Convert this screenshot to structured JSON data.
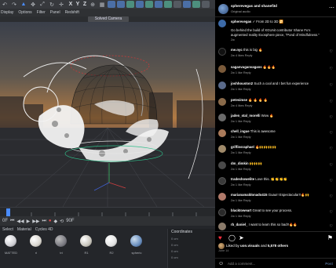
{
  "app": {
    "menu": [
      "Display",
      "Options",
      "Filter",
      "Panel",
      "Redshift"
    ],
    "camera_label": "Solved Camera",
    "axes": [
      "X",
      "Y",
      "Z"
    ],
    "transport_labels": [
      "0F",
      "90F"
    ],
    "material_tabs": [
      "Select",
      "Material",
      "Cycles 4D"
    ],
    "materials": [
      {
        "label": "MATTED",
        "color": "#cfcfd4"
      },
      {
        "label": "ri",
        "color": "#d9d6cf"
      },
      {
        "label": "tri",
        "color": "#7b7b82"
      },
      {
        "label": "R1",
        "color": "#c9c6bd"
      },
      {
        "label": "R2",
        "color": "#e3e3e3"
      },
      {
        "label": "spheric",
        "color": "#6a8fbf"
      }
    ],
    "coords_title": "Coordinates",
    "coords_rows": [
      "0 cm",
      "0 cm",
      "0 cm",
      "0 cm"
    ]
  },
  "panel": {
    "header": {
      "name": "spherevegas and shanef3d",
      "sub": "Original audio"
    },
    "comments": [
      {
        "user": "spherevegas",
        "text": "✓ From 2D to 3D 🔁",
        "detail": "Go behind the build of XGUnit contributor Shane Fu's augmented reality Exosphere piece, \"Pond of Mindfulness.\"",
        "meta": "2w",
        "color": "#3c6aa8"
      },
      {
        "user": "me.nyc",
        "text": "this is big 🔥",
        "meta": "2w   4 likes   Reply",
        "color": "#111"
      },
      {
        "user": "saganvaganvagans",
        "text": "🔥🔥🔥",
        "meta": "2w   1 like   Reply",
        "color": "#7a5a3a"
      },
      {
        "user": "joshhouston2",
        "text": "Such a cool and I bet fun experience",
        "meta": "2w   1 like   Reply",
        "color": "#5a6a8a"
      },
      {
        "user": "petesimse",
        "text": "🔥 🔥 🔥 🔥",
        "meta": "2w   4 likes   Reply",
        "color": "#8a6a4a"
      },
      {
        "user": "jaden_stal_morelli",
        "text": "Wow 🔥",
        "meta": "2w   1 like   Reply",
        "color": "#6a6a6a"
      },
      {
        "user": "chell_ingue",
        "text": "This is awesome",
        "meta": "2w   1 like   Reply",
        "color": "#aa7a5a"
      },
      {
        "user": "griffinsraphael",
        "text": "🔥🙌🙌🙌🙌",
        "meta": "2w   1 like   Reply",
        "color": "#a08a6a"
      },
      {
        "user": "dm_dimkin",
        "text": "🙌🙌🙌",
        "meta": "2w   1 like   Reply",
        "color": "#4a4a4a"
      },
      {
        "user": "tradeshowelite",
        "text": "Love this. 👏👏👏👏",
        "meta": "2w   1 like   Reply",
        "color": "#3a3a3a"
      },
      {
        "user": "marianamaldonado415",
        "text": "Guau!! Espectacular!!🔥🙌",
        "meta": "2w   1 like   Reply",
        "color": "#b07a6a"
      },
      {
        "user": "blacktoweart",
        "text": "Great to see your process.",
        "meta": "2w   1 like   Reply",
        "color": "#2a2a2a"
      },
      {
        "user": "rb_daniel_",
        "text": "I want to learn this so bad!!🔥🔥",
        "meta": "2w   1 like   Reply",
        "color": "#8a7a6a"
      }
    ],
    "likes": {
      "prefix": "Liked by",
      "user": "uon.visuals",
      "suffix": "and",
      "count": "5,578 others"
    },
    "date": "June 14",
    "add_comment": {
      "placeholder": "Add a comment...",
      "post": "Post"
    }
  }
}
